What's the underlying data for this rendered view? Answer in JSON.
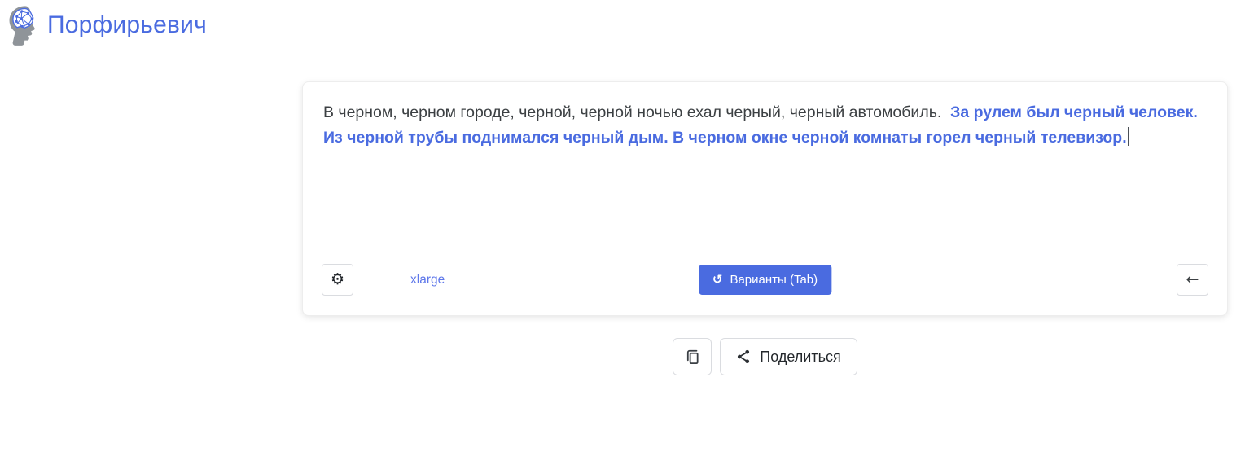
{
  "header": {
    "title": "Порфирьевич"
  },
  "editor": {
    "prompt_text": "В черном, черном городе, черной, черной ночью ехал черный, черный автомобиль. ",
    "generated_text": " За рулем был черный человек. Из черной трубы поднимался черный дым. В черном окне черной комнаты горел черный телевизор.",
    "controls": {
      "model_label": "xlarge",
      "variants_button": {
        "label": "Варианты (Tab)"
      }
    }
  },
  "actions": {
    "share_button": {
      "label": "Поделиться"
    }
  },
  "icons": {
    "gear": "⚙",
    "refresh_ccw": "↺",
    "arrow_left": "←"
  },
  "colors": {
    "accent": "#4a6be0",
    "link": "#5f78ea",
    "text": "#3c4043",
    "border": "#dadce0"
  }
}
